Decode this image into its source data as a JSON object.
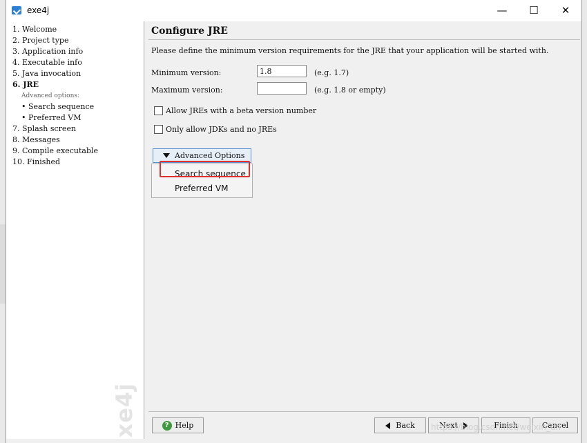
{
  "window": {
    "title": "exe4j",
    "minimize": "—",
    "maximize": "☐",
    "close": "✕"
  },
  "sidebar": {
    "steps": [
      {
        "label": "1.  Welcome"
      },
      {
        "label": "2.  Project type"
      },
      {
        "label": "3.  Application info"
      },
      {
        "label": "4.  Executable info"
      },
      {
        "label": "5.  Java invocation"
      },
      {
        "label": "6.  JRE"
      },
      {
        "label": "Advanced options:"
      },
      {
        "label": "• Search sequence"
      },
      {
        "label": "• Preferred VM"
      },
      {
        "label": "7.  Splash screen"
      },
      {
        "label": "8.  Messages"
      },
      {
        "label": "9.  Compile executable"
      },
      {
        "label": "10.  Finished"
      }
    ],
    "watermark": "exe4j"
  },
  "main": {
    "heading": "Configure JRE",
    "description": "Please define the minimum version requirements for the JRE that your application will be started with.",
    "min_version": {
      "label": "Minimum version:",
      "value": "1.8",
      "hint": "(e.g. 1.7)"
    },
    "max_version": {
      "label": "Maximum version:",
      "value": "",
      "hint": "(e.g. 1.8 or empty)"
    },
    "checks": {
      "beta": {
        "label": "Allow JREs with a beta version number",
        "checked": false
      },
      "jdk_only": {
        "label": "Only allow JDKs and no JREs",
        "checked": false
      }
    },
    "advanced_button": "Advanced Options",
    "advanced_menu": [
      "Search sequence",
      "Preferred VM"
    ]
  },
  "footer": {
    "help": "Help",
    "back": "Back",
    "next": "Next",
    "finish": "Finish",
    "cancel": "Cancel"
  },
  "watermark_url": "https://blog.csdn.net/weixin_dn",
  "colors": {
    "highlight": "#e0302b",
    "help_icon": "#3f9a3f",
    "accent": "#2d7fd3"
  },
  "icons": [
    "exe4j-app-icon",
    "help-icon",
    "back-arrow-icon",
    "next-arrow-icon",
    "dropdown-triangle-icon"
  ]
}
